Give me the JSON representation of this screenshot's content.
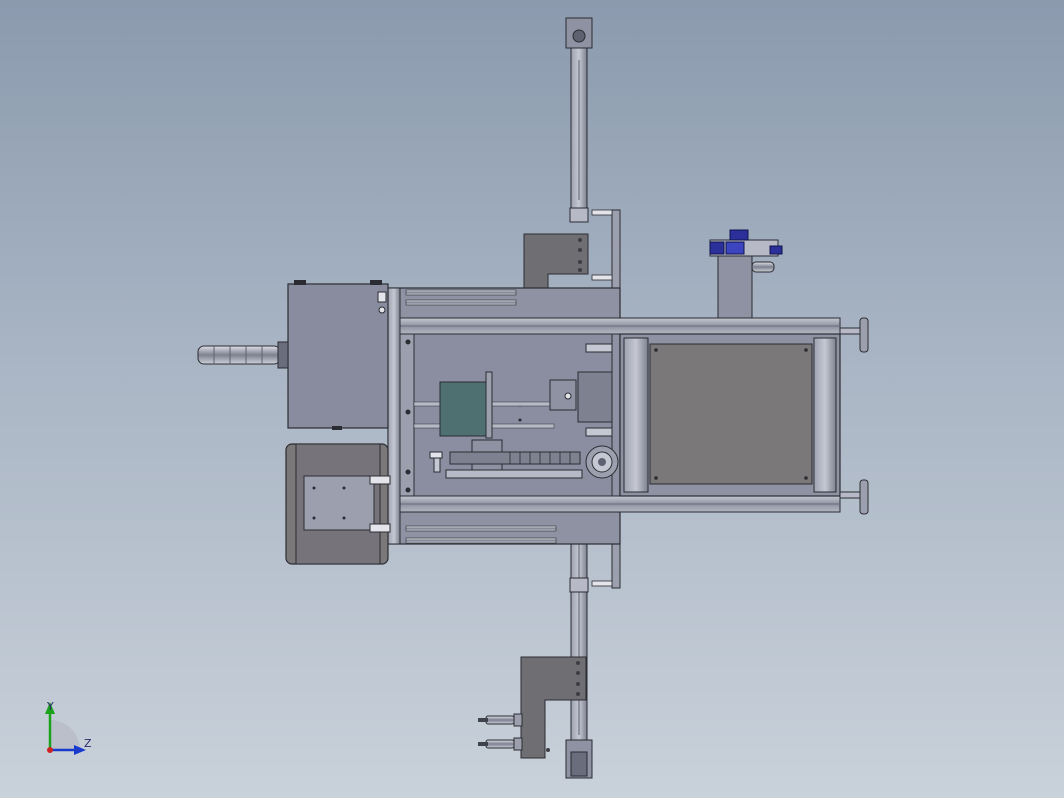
{
  "viewport": {
    "background_top": "#8b9aae",
    "background_bottom": "#c9d1da"
  },
  "colors": {
    "steel": "#8e92a2",
    "steel_dark": "#5e6270",
    "steel_light": "#b7bac6",
    "bracket": "#6f6e73",
    "panel": "#7a7878",
    "motor_box": "#888c9e",
    "glass": "#4f7070",
    "line": "#2b2c33",
    "valve_blue": "#2a2f9a"
  },
  "triad": {
    "y_label": "Y",
    "z_label": "Z",
    "y_color": "#1aa31a",
    "z_color": "#1a3acc",
    "origin_color": "#cc2222"
  }
}
